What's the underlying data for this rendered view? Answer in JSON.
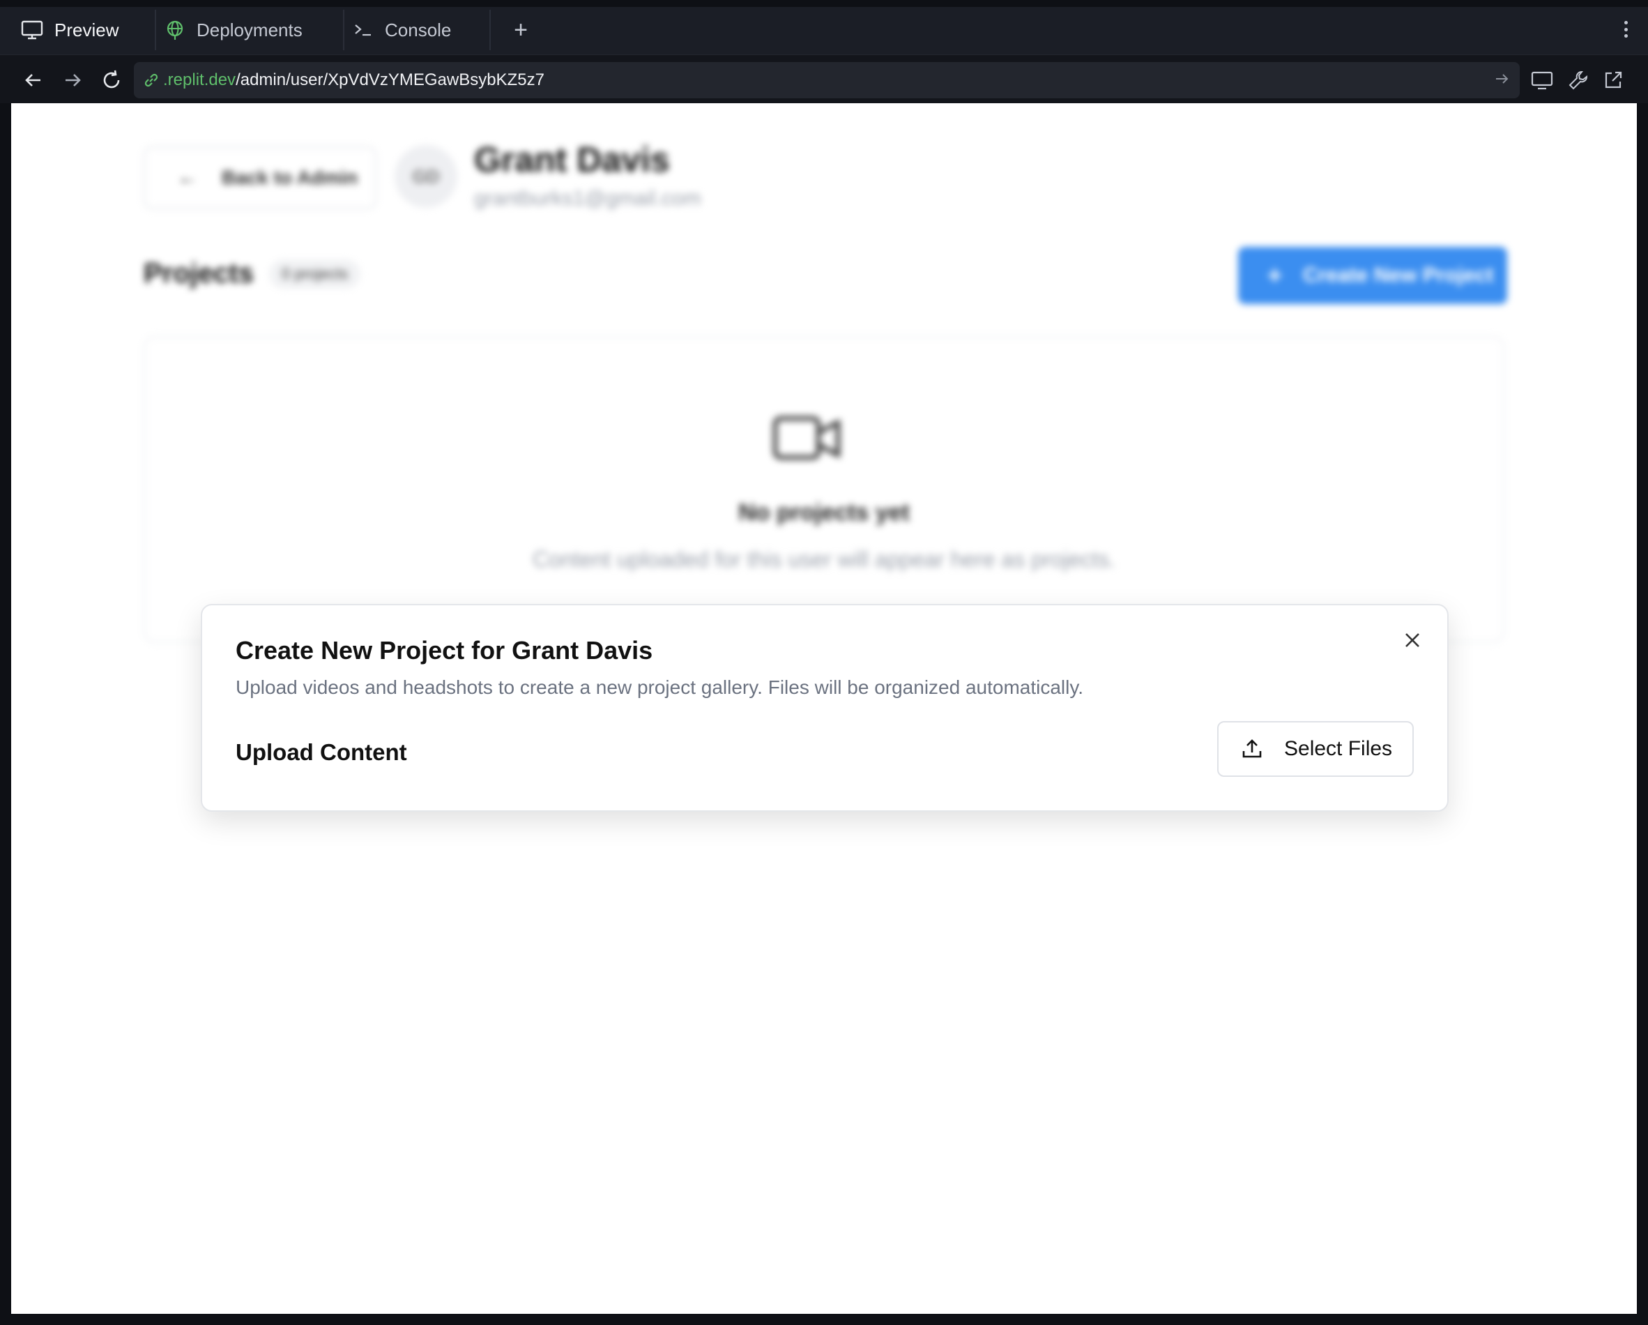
{
  "tabs": [
    {
      "label": "Preview",
      "icon": "monitor-icon",
      "active": true
    },
    {
      "label": "Deployments",
      "icon": "globe-icon",
      "active": false
    },
    {
      "label": "Console",
      "icon": "terminal-icon",
      "active": false
    }
  ],
  "new_tab_label": "+",
  "url": {
    "domain": ".replit.dev",
    "path": "/admin/user/XpVdVzYMEGawBsybKZ5z7"
  },
  "page": {
    "back_label": "Back to Admin",
    "avatar_initials": "GD",
    "user_name": "Grant Davis",
    "user_email": "grantburks1@gmail.com",
    "projects_title": "Projects",
    "projects_count": "0 projects",
    "create_button": "Create New Project",
    "empty_title": "No projects yet",
    "empty_desc": "Content uploaded for this user will appear here as projects."
  },
  "modal": {
    "title": "Create New Project for Grant Davis",
    "description": "Upload videos and headshots to create a new project gallery. Files will be organized automatically.",
    "upload_label": "Upload Content",
    "select_button": "Select Files"
  },
  "colors": {
    "accent_blue": "#3b8ef0",
    "domain_green": "#5fbf6b",
    "chrome_dark": "#1b1e26"
  }
}
